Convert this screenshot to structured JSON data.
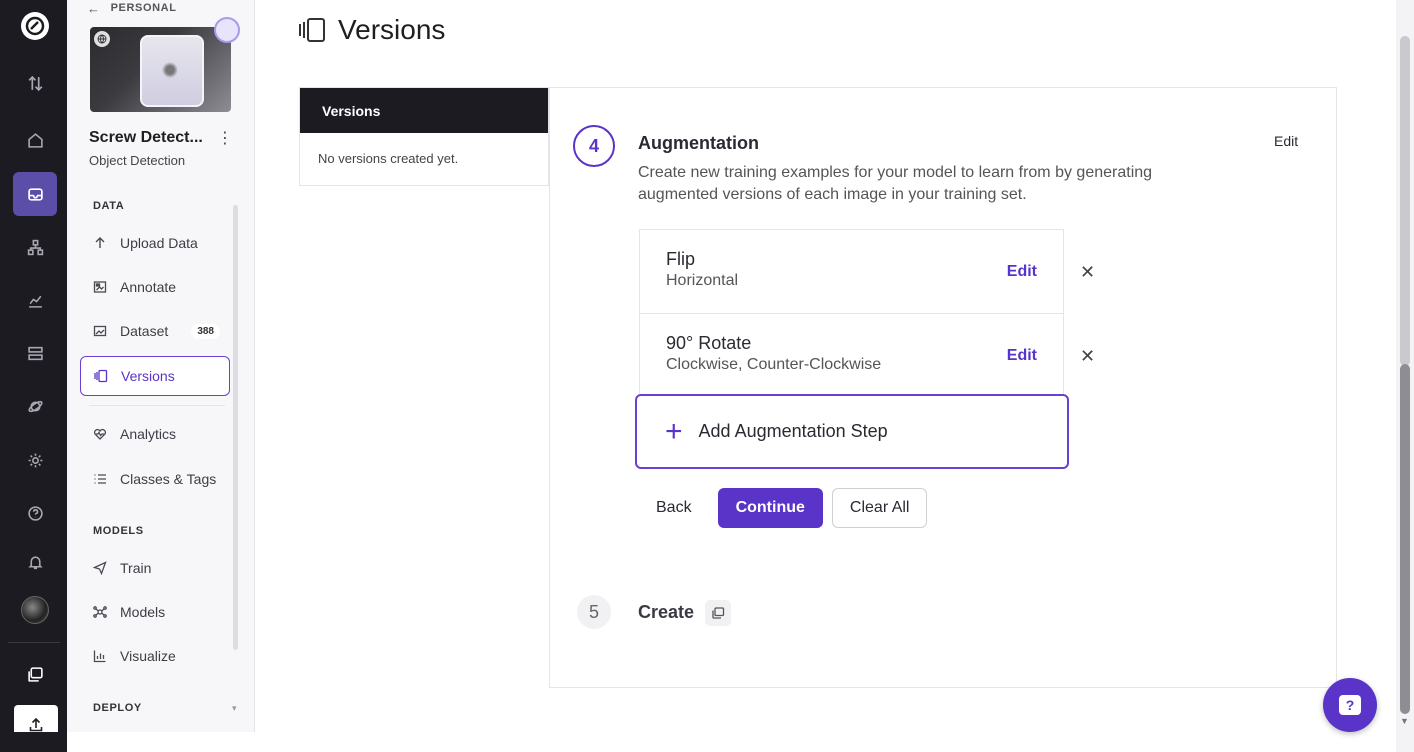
{
  "sidebar": {
    "back_label": "PERSONAL",
    "project_name": "Screw Detect...",
    "project_type": "Object Detection",
    "sections": {
      "data": "DATA",
      "models": "MODELS",
      "deploy": "DEPLOY"
    },
    "items": [
      {
        "label": "Upload Data",
        "icon": "upload-arrow-icon"
      },
      {
        "label": "Annotate",
        "icon": "annotate-icon"
      },
      {
        "label": "Dataset",
        "icon": "dataset-icon",
        "badge": "388"
      },
      {
        "label": "Versions",
        "icon": "versions-icon",
        "active": true
      },
      {
        "label": "Analytics",
        "icon": "analytics-icon"
      },
      {
        "label": "Classes & Tags",
        "icon": "list-icon"
      },
      {
        "label": "Train",
        "icon": "train-icon"
      },
      {
        "label": "Models",
        "icon": "models-icon"
      },
      {
        "label": "Visualize",
        "icon": "visualize-icon"
      }
    ]
  },
  "header": {
    "title": "Versions"
  },
  "versions_panel": {
    "heading": "Versions",
    "empty_text": "No versions created yet."
  },
  "step4": {
    "number": "4",
    "title": "Augmentation",
    "edit_label": "Edit",
    "description": "Create new training examples for your model to learn from by generating augmented versions of each image in your training set.",
    "augmentations": [
      {
        "name": "Flip",
        "detail": "Horizontal",
        "edit": "Edit"
      },
      {
        "name": "90° Rotate",
        "detail": "Clockwise, Counter-Clockwise",
        "edit": "Edit"
      }
    ],
    "add_label": "Add Augmentation Step",
    "back_label": "Back",
    "continue_label": "Continue",
    "clear_label": "Clear All"
  },
  "step5": {
    "number": "5",
    "title": "Create"
  },
  "colors": {
    "accent": "#5a33c9",
    "rail_bg": "#1c1b22",
    "rail_active": "#5a4ea8"
  }
}
